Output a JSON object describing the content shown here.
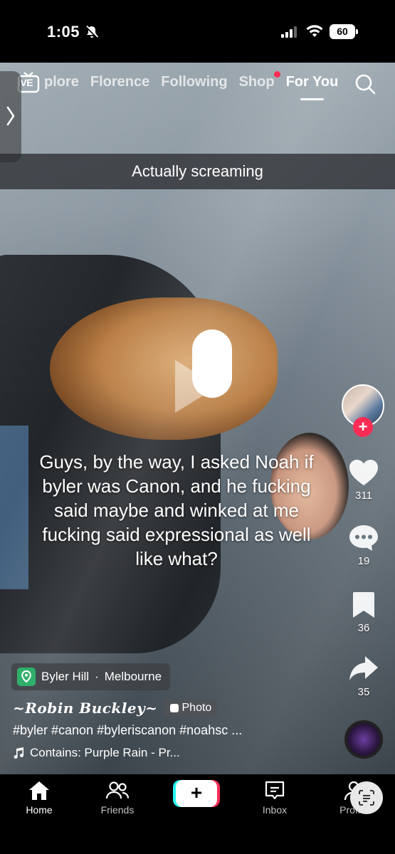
{
  "status_bar": {
    "time": "1:05",
    "battery": "60"
  },
  "top_nav": {
    "live_label": "IVE",
    "tabs": [
      {
        "label": "plore"
      },
      {
        "label": "Florence"
      },
      {
        "label": "Following"
      },
      {
        "label": "Shop"
      },
      {
        "label": "For You"
      }
    ]
  },
  "video": {
    "caption_bar": "Actually screaming",
    "overlay_text": "Guys, by the way, I asked Noah if byler was Canon, and he fucking said maybe and winked at me fucking said expressional as well like what?"
  },
  "rail": {
    "likes": "311",
    "comments": "19",
    "saves": "36",
    "shares": "35",
    "follow_glyph": "+"
  },
  "info": {
    "location_name": "Byler Hill",
    "location_city": "Melbourne",
    "location_sep": "·",
    "username": "~Robin Buckley~",
    "photo_badge": "Photo",
    "hashtags": "#byler #canon #byleriscanon #noahsc ...",
    "music": "Contains: Purple Rain - Pr..."
  },
  "tab_bar": {
    "home": "Home",
    "friends": "Friends",
    "create": "+",
    "inbox": "Inbox",
    "profile": "Profile"
  },
  "colors": {
    "accent_red": "#fe2c55",
    "accent_cyan": "#25f4ee",
    "location_green": "#2fb06a"
  }
}
